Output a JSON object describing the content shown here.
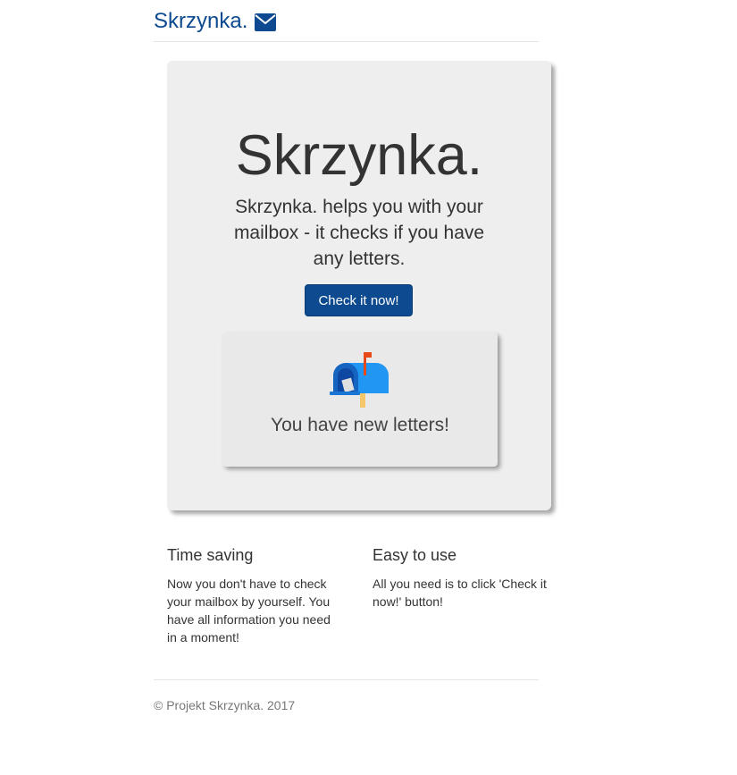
{
  "header": {
    "brand": "Skrzynka.",
    "brand_icon": "envelope-icon",
    "brand_color": "#0d4a8f"
  },
  "hero": {
    "title": "Skrzynka.",
    "lead": "Skrzynka. helps you with your mailbox - it checks if you have any letters.",
    "button_label": "Check it now!",
    "button_color": "#0d4a8f"
  },
  "result": {
    "icon": "mailbox-with-flag-up-icon",
    "message": "You have new letters!"
  },
  "features": [
    {
      "title": "Time saving",
      "text": "Now you don't have to check your mailbox by yourself. You have all information you need in a moment!"
    },
    {
      "title": "Easy to use",
      "text": "All you need is to click 'Check it now!' button!"
    }
  ],
  "footer": {
    "text": "© Projekt Skrzynka. 2017"
  }
}
